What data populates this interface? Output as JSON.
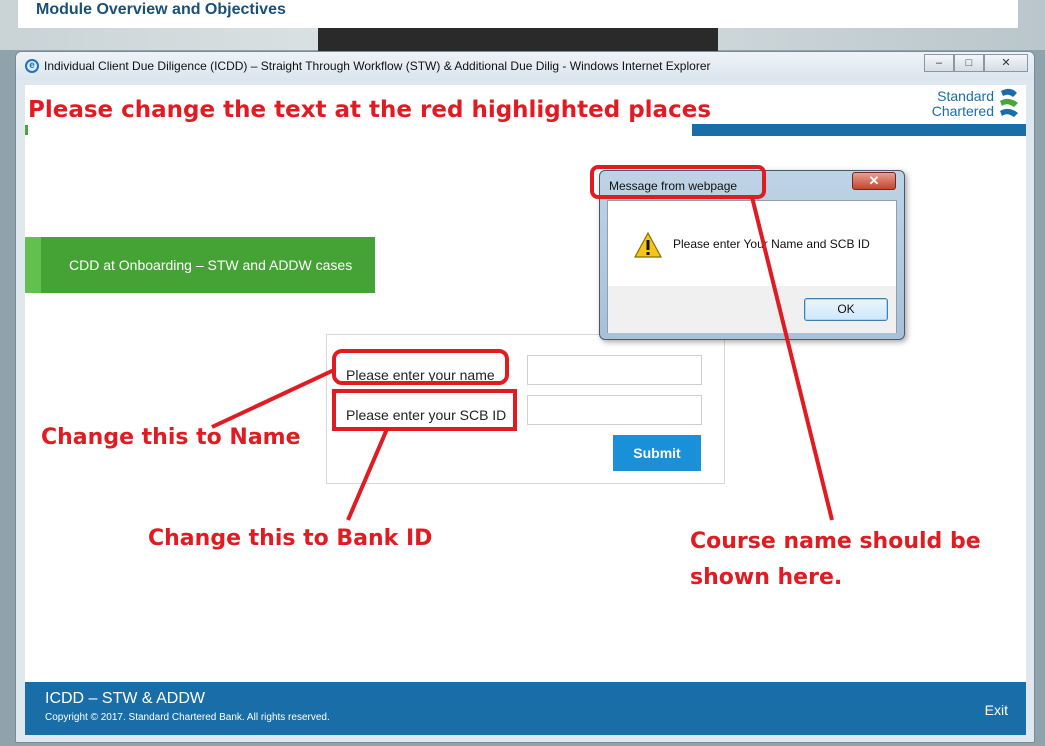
{
  "background": {
    "heading": "Module Overview and Objectives"
  },
  "window": {
    "title": "Individual Client Due Diligence (ICDD) – Straight Through Workflow (STW) & Additional Due Dilig - Windows Internet Explorer",
    "minimize_label": "–",
    "restore_label": "□",
    "close_label": "✕"
  },
  "brand": {
    "line1": "Standard",
    "line2": "Chartered",
    "color": "#1a6ea8"
  },
  "banner": {
    "label": "CDD at Onboarding – STW and ADDW cases",
    "color": "#45a335"
  },
  "form": {
    "name_label": "Please enter your name",
    "id_label": "Please enter your SCB ID",
    "name_value": "",
    "id_value": "",
    "submit_label": "Submit"
  },
  "footer": {
    "title": "ICDD – STW & ADDW",
    "copyright": "Copyright © 2017. Standard Chartered Bank. All rights reserved.",
    "exit_label": "Exit"
  },
  "dialog": {
    "title": "Message from webpage",
    "close_label": "✕",
    "message": "Please enter Your Name and SCB ID",
    "ok_label": "OK"
  },
  "annotations": {
    "top": "Please change the text at the red highlighted places",
    "name": "Change this to Name",
    "bank": "Change this to Bank ID",
    "course": "Course name should be shown here.",
    "color": "#e11b22"
  }
}
